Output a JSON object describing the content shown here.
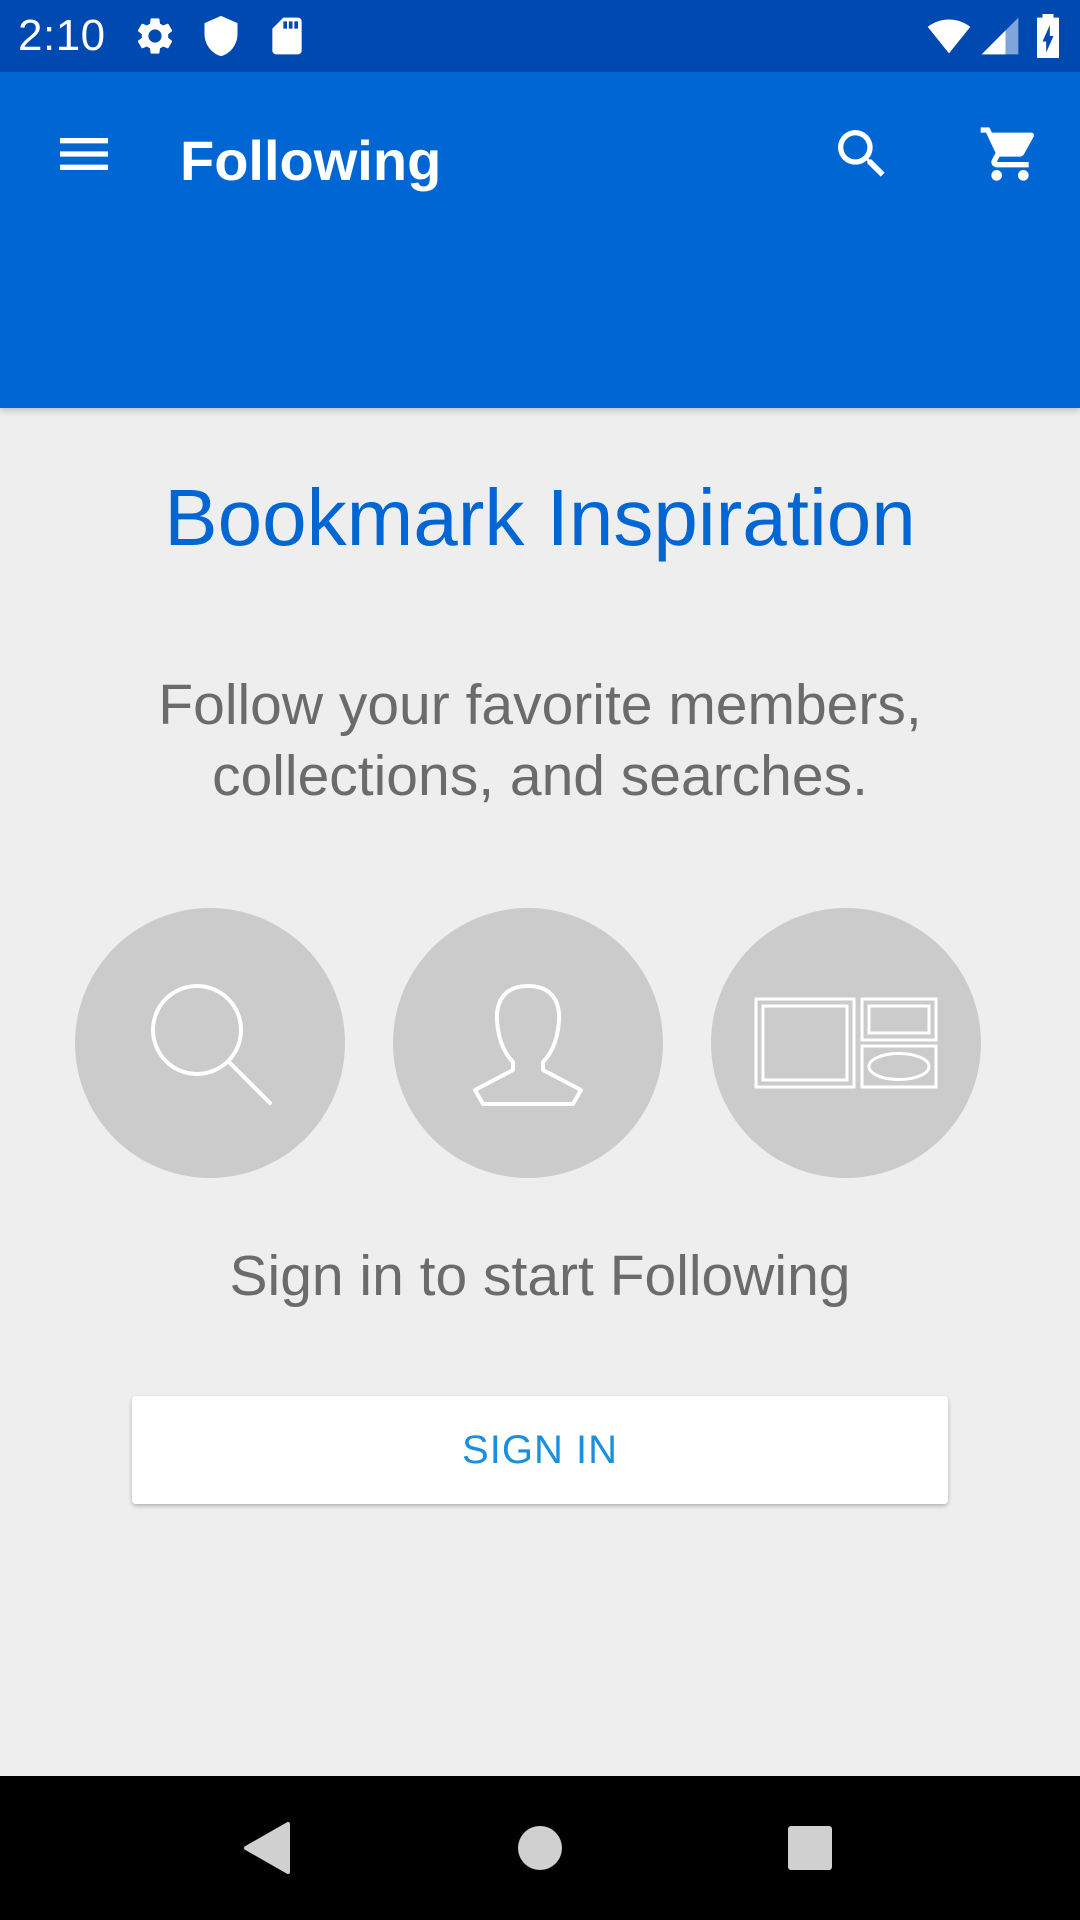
{
  "status_bar": {
    "time": "2:10",
    "icons": [
      "settings-gear-icon",
      "shield-icon",
      "sd-card-icon",
      "wifi-icon",
      "cell-signal-icon",
      "battery-charging-icon"
    ]
  },
  "app_bar": {
    "title": "Following",
    "menu_icon": "hamburger-menu-icon",
    "search_icon": "search-icon",
    "cart_icon": "shopping-cart-icon"
  },
  "content": {
    "heading": "Bookmark Inspiration",
    "subtitle_line1": "Follow your favorite members,",
    "subtitle_line2": "collections, and searches.",
    "features": [
      {
        "icon": "search-outline-icon"
      },
      {
        "icon": "person-outline-icon"
      },
      {
        "icon": "collection-outline-icon"
      }
    ],
    "prompt": "Sign in to start Following",
    "sign_in_label": "SIGN IN"
  },
  "nav_bar": {
    "back_icon": "back-triangle-icon",
    "home_icon": "home-circle-icon",
    "recents_icon": "recents-square-icon"
  },
  "colors": {
    "status_bar": "#0049b0",
    "app_bar": "#0066d4",
    "background": "#eeeeee",
    "heading": "#0066d4",
    "body_text": "#6b6b6b",
    "circle": "#cbcbcb",
    "button_text": "#1a8fe0",
    "nav_bar": "#000000"
  }
}
